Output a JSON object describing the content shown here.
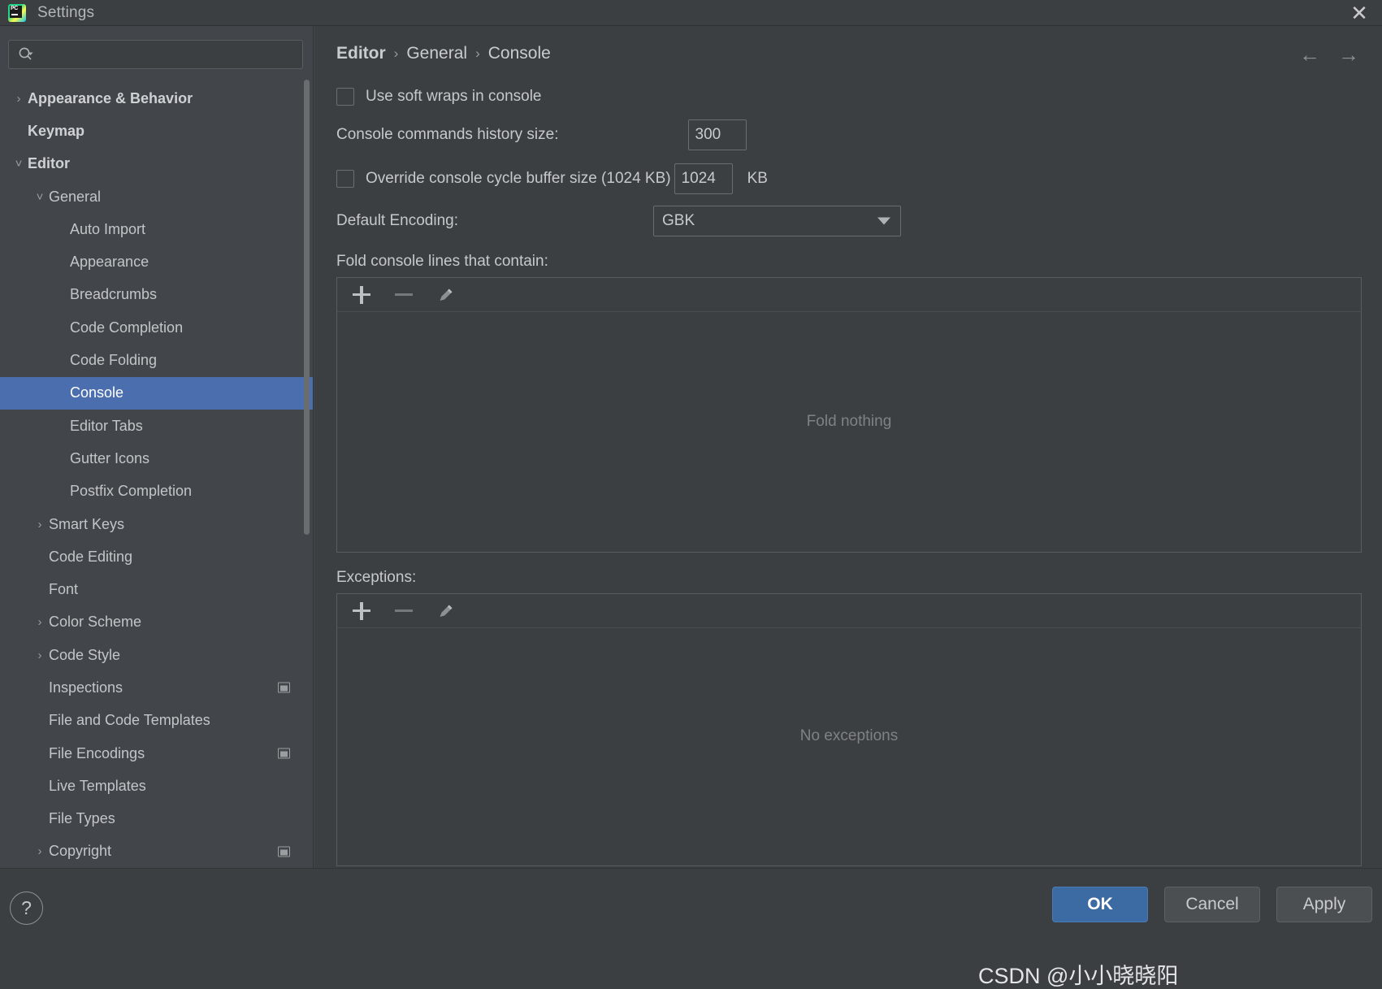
{
  "window": {
    "title": "Settings",
    "app_icon": "pycharm-logo-icon",
    "close_label": "✕"
  },
  "search": {
    "placeholder": "",
    "value": "",
    "icon": "search-icon"
  },
  "sidebar": {
    "items": [
      {
        "label": "Appearance & Behavior",
        "indent": 0,
        "arrow": "›",
        "bold": true,
        "selected": false,
        "badge": false
      },
      {
        "label": "Keymap",
        "indent": 0,
        "arrow": "",
        "bold": true,
        "selected": false,
        "badge": false
      },
      {
        "label": "Editor",
        "indent": 0,
        "arrow": "⌄",
        "bold": true,
        "selected": false,
        "badge": false
      },
      {
        "label": "General",
        "indent": 1,
        "arrow": "⌄",
        "bold": false,
        "selected": false,
        "badge": false
      },
      {
        "label": "Auto Import",
        "indent": 2,
        "arrow": "",
        "bold": false,
        "selected": false,
        "badge": false
      },
      {
        "label": "Appearance",
        "indent": 2,
        "arrow": "",
        "bold": false,
        "selected": false,
        "badge": false
      },
      {
        "label": "Breadcrumbs",
        "indent": 2,
        "arrow": "",
        "bold": false,
        "selected": false,
        "badge": false
      },
      {
        "label": "Code Completion",
        "indent": 2,
        "arrow": "",
        "bold": false,
        "selected": false,
        "badge": false
      },
      {
        "label": "Code Folding",
        "indent": 2,
        "arrow": "",
        "bold": false,
        "selected": false,
        "badge": false
      },
      {
        "label": "Console",
        "indent": 2,
        "arrow": "",
        "bold": false,
        "selected": true,
        "badge": false
      },
      {
        "label": "Editor Tabs",
        "indent": 2,
        "arrow": "",
        "bold": false,
        "selected": false,
        "badge": false
      },
      {
        "label": "Gutter Icons",
        "indent": 2,
        "arrow": "",
        "bold": false,
        "selected": false,
        "badge": false
      },
      {
        "label": "Postfix Completion",
        "indent": 2,
        "arrow": "",
        "bold": false,
        "selected": false,
        "badge": false
      },
      {
        "label": "Smart Keys",
        "indent": 1,
        "arrow": "›",
        "bold": false,
        "selected": false,
        "badge": false
      },
      {
        "label": "Code Editing",
        "indent": 1,
        "arrow": "",
        "bold": false,
        "selected": false,
        "badge": false
      },
      {
        "label": "Font",
        "indent": 1,
        "arrow": "",
        "bold": false,
        "selected": false,
        "badge": false
      },
      {
        "label": "Color Scheme",
        "indent": 1,
        "arrow": "›",
        "bold": false,
        "selected": false,
        "badge": false
      },
      {
        "label": "Code Style",
        "indent": 1,
        "arrow": "›",
        "bold": false,
        "selected": false,
        "badge": false
      },
      {
        "label": "Inspections",
        "indent": 1,
        "arrow": "",
        "bold": false,
        "selected": false,
        "badge": true
      },
      {
        "label": "File and Code Templates",
        "indent": 1,
        "arrow": "",
        "bold": false,
        "selected": false,
        "badge": false
      },
      {
        "label": "File Encodings",
        "indent": 1,
        "arrow": "",
        "bold": false,
        "selected": false,
        "badge": true
      },
      {
        "label": "Live Templates",
        "indent": 1,
        "arrow": "",
        "bold": false,
        "selected": false,
        "badge": false
      },
      {
        "label": "File Types",
        "indent": 1,
        "arrow": "",
        "bold": false,
        "selected": false,
        "badge": false
      },
      {
        "label": "Copyright",
        "indent": 1,
        "arrow": "›",
        "bold": false,
        "selected": false,
        "badge": true
      }
    ]
  },
  "main": {
    "breadcrumb": [
      "Editor",
      "General",
      "Console"
    ],
    "breadcrumb_separator": "›",
    "nav_back": "←",
    "nav_forward": "→",
    "soft_wraps_label": "Use soft wraps in console",
    "soft_wraps_checked": false,
    "history_size_label": "Console commands history size:",
    "history_size_value": "300",
    "override_buffer_label": "Override console cycle buffer size (1024 KB)",
    "override_buffer_checked": false,
    "buffer_size_value": "1024",
    "buffer_unit": "KB",
    "encoding_label": "Default Encoding:",
    "encoding_value": "GBK",
    "fold_label": "Fold console lines that contain:",
    "fold_empty_text": "Fold nothing",
    "exceptions_label": "Exceptions:",
    "exceptions_empty_text": "No exceptions",
    "toolbar": {
      "add": "add-icon",
      "remove": "remove-icon",
      "edit": "edit-pencil-icon"
    }
  },
  "bottom": {
    "help_label": "?",
    "ok_label": "OK",
    "cancel_label": "Cancel",
    "apply_label": "Apply"
  },
  "watermark": "CSDN @小小晓晓阳",
  "colors": {
    "accent": "#4b6eaf",
    "primary_button": "#3c6ba3",
    "panel_bg": "#3c3f41",
    "sidebar_bg": "#42454a",
    "text": "#c6c9cb"
  }
}
